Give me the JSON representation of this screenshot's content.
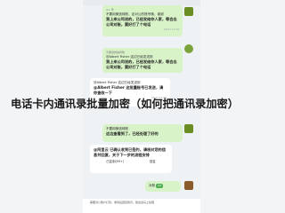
{
  "overlay": {
    "title": "电话卡内通讯录批量加密（如何把通讯录加密）"
  },
  "chat": {
    "messages": [
      {
        "side": "right",
        "meta": "4.1 号",
        "line1": "不要用微信转账，走对公的账号哦，谢谢",
        "bold": "我上来公司说的，已经发给你人家，等会出公司对账，要好打了个电话",
        "time": "09:41 11:56"
      },
      {
        "side": "right",
        "meta": "不要用微信转账",
        "line1": "@Albert Fisher 这边已经发送到",
        "bold": "我上来公司说的，已经发给你人家，等会出公司对账，要好打了个电话",
        "time": "09:41 11:56"
      },
      {
        "side": "left",
        "line1": "@Albert Fisher 这边已经发送到",
        "bold": "@Albert Fisher 这批量账号已发送，请你查收一下",
        "time": "09:41 11:58"
      },
      {
        "side": "right",
        "line1": "不要用微信转账",
        "bold": "这边查看到了，已经处理了好的",
        "time": "09:41 11:58"
      },
      {
        "side": "left",
        "bold": "@阿里云 已确认收到已签约，请核对您的信息并回复，关于下一步的流程安排",
        "btn1": "已复制(99+)",
        "btn2": "回复",
        "time": "09:41 11:58"
      },
      {
        "side": "right",
        "line1": "对账",
        "badge": "02",
        "time": "09:41"
      },
      {
        "side": "left",
        "line1": "需要对公账户打款，收到后回复我们，我这边马上处理",
        "time": ""
      }
    ]
  }
}
